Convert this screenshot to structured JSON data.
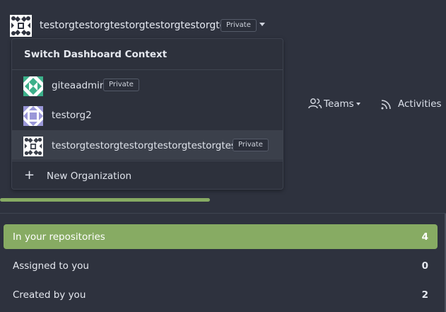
{
  "header": {
    "org_name": "testorgtestorgtestorgtestorgtestorgtesto",
    "org_badge": "Private",
    "org_icon": "identicon-avatar",
    "caret_icon": "chevron-down-icon"
  },
  "context_menu": {
    "title": "Switch Dashboard Context",
    "items": [
      {
        "label": "giteaadmin",
        "badge": "Private",
        "avatar_color": "#3cb08a"
      },
      {
        "label": "testorg2",
        "badge": "",
        "avatar_color": "#9a97d8"
      },
      {
        "label": "testorgtestorgtestorgtestorgtestorgtesto",
        "badge": "Private",
        "avatar_color": "#ffffff"
      }
    ],
    "new_org_label": "New Organization"
  },
  "nav": {
    "teams_label": "Teams",
    "activities_label": "Activities"
  },
  "progress": {
    "value_percent": 47
  },
  "filters": [
    {
      "label": "In your repositories",
      "count": "4",
      "active": true
    },
    {
      "label": "Assigned to you",
      "count": "0",
      "active": false
    },
    {
      "label": "Created by you",
      "count": "2",
      "active": false
    }
  ],
  "colors": {
    "accent": "#87ab63",
    "background": "#2e323e",
    "menu_active": "#3b404b"
  }
}
